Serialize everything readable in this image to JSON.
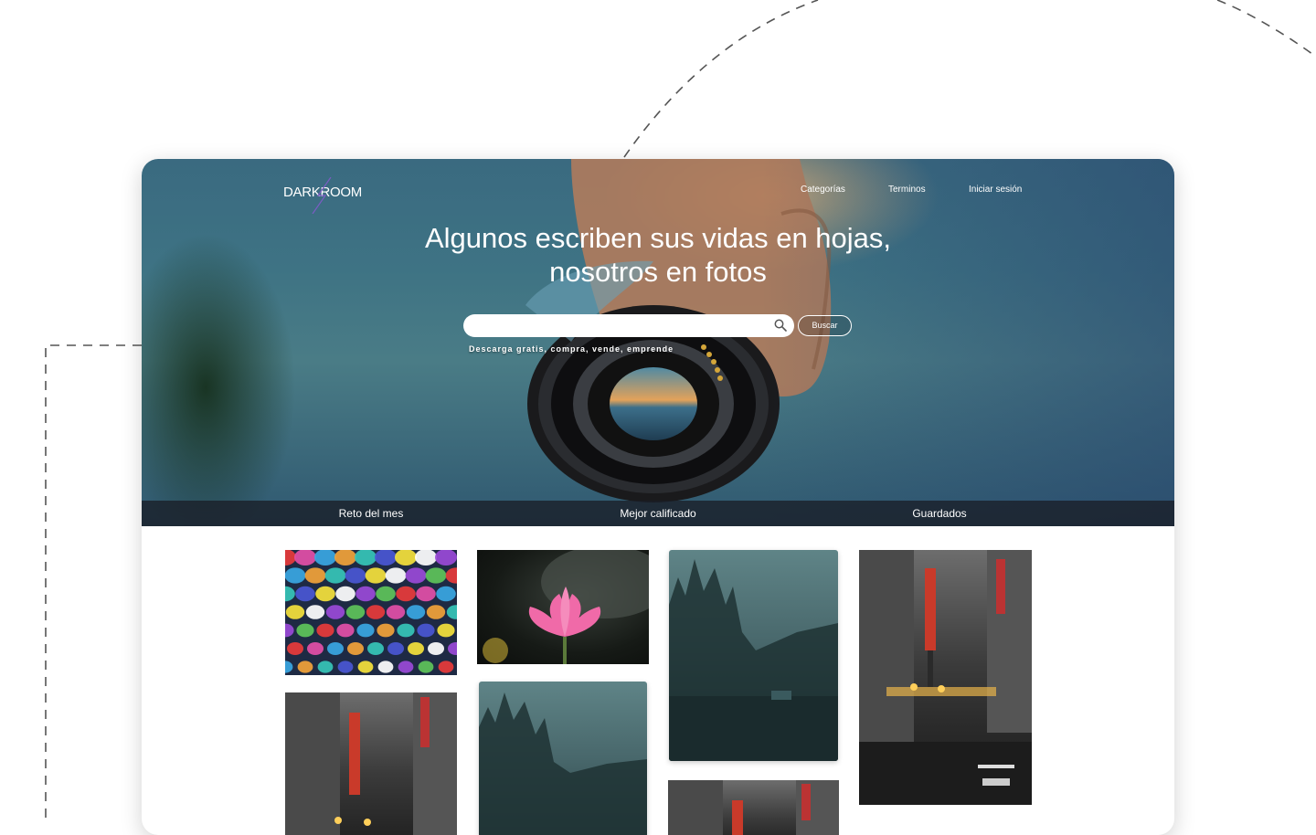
{
  "brand": {
    "logo_text": "DARKROOM"
  },
  "nav": {
    "categorias": "Categorías",
    "terminos": "Terminos",
    "login": "Iniciar sesión"
  },
  "hero": {
    "headline_line1": "Algunos escriben sus vidas en hojas,",
    "headline_line2": "nosotros en fotos",
    "search_value": "",
    "search_button": "Buscar",
    "tagline": "Descarga gratis, compra, vende, emprende"
  },
  "tabs": [
    "Reto del mes",
    "Mejor calificado",
    "Guardados"
  ],
  "gallery": {
    "photos": [
      {
        "subject": "colorful umbrellas"
      },
      {
        "subject": "pink lotus flower"
      },
      {
        "subject": "misty forest lake"
      },
      {
        "subject": "city street with neon sign"
      },
      {
        "subject": "city street with neon sign"
      },
      {
        "subject": "misty forest lake"
      },
      {
        "subject": "city street with neon sign"
      }
    ]
  },
  "colors": {
    "hero_sky": "#3e7384",
    "hero_sunset": "#d6aa76",
    "tab_bar": "#191e26",
    "logo_accent": "#7b5cc4"
  }
}
